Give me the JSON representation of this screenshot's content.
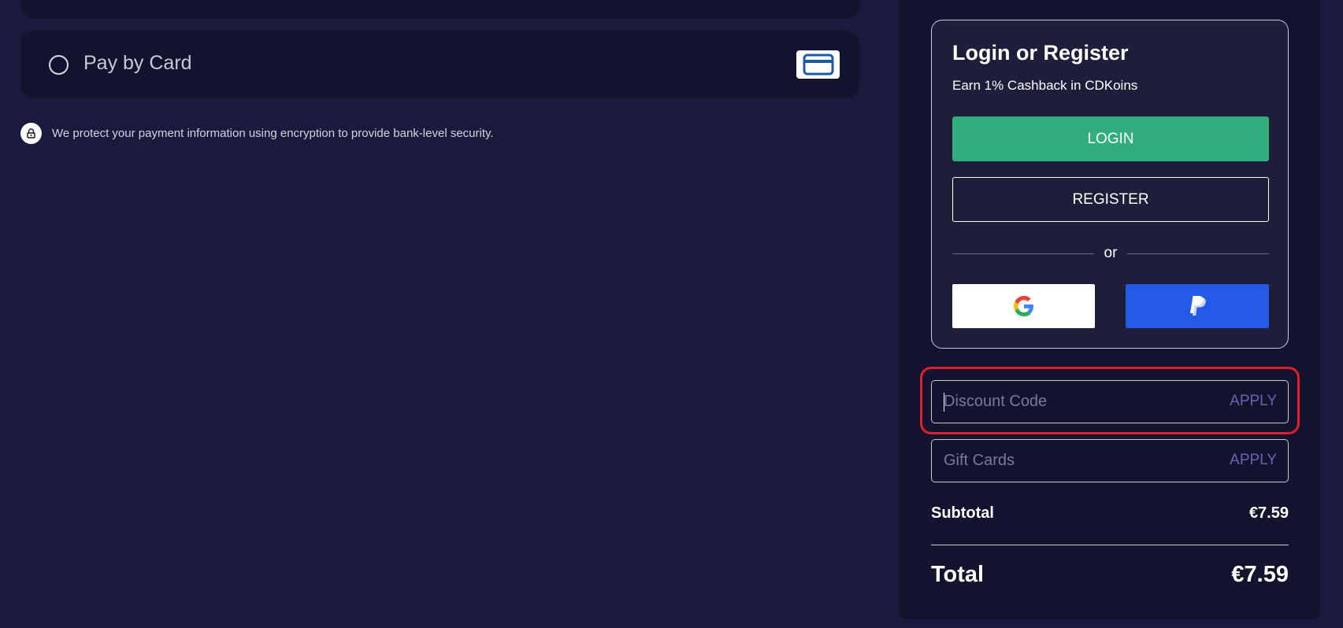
{
  "payment": {
    "pay_by_card_label": "Pay by Card",
    "security_note": "We protect your payment information using encryption to provide bank-level security."
  },
  "login": {
    "title": "Login or Register",
    "subtitle": "Earn 1% Cashback in CDKoins",
    "login_label": "LOGIN",
    "register_label": "REGISTER",
    "or_label": "or"
  },
  "discount": {
    "placeholder": "Discount Code",
    "value": "",
    "apply_label": "APPLY"
  },
  "gift": {
    "placeholder": "Gift Cards",
    "value": "",
    "apply_label": "APPLY"
  },
  "summary": {
    "subtotal_label": "Subtotal",
    "subtotal_value": "€7.59",
    "total_label": "Total",
    "total_value": "€7.59"
  },
  "colors": {
    "background": "#1b1a3d",
    "panel": "#14132e",
    "login_green": "#31ae7e",
    "paypal_blue": "#2359e5",
    "highlight_red": "#e01f2b",
    "apply_purple": "#6665b5"
  }
}
